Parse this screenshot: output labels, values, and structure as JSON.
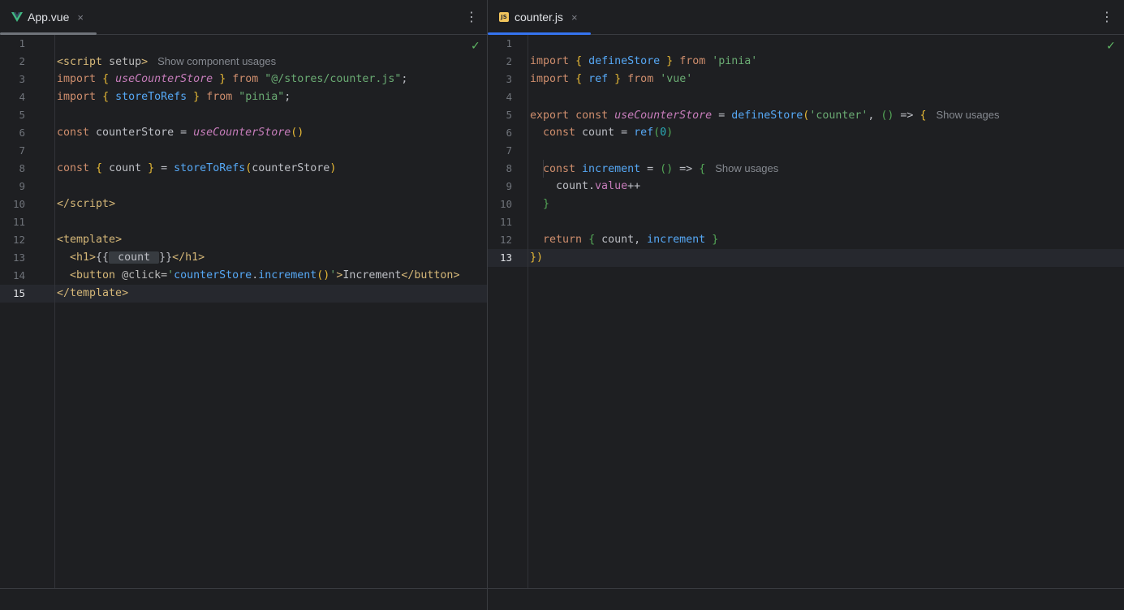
{
  "left": {
    "tab": {
      "label": "App.vue",
      "icon": "vue-icon",
      "close": "×"
    },
    "more": "⋮",
    "check": "✓",
    "hint_script": "Show component usages",
    "current_line": "15",
    "line_numbers": [
      "1",
      "2",
      "3",
      "4",
      "5",
      "6",
      "7",
      "8",
      "9",
      "10",
      "11",
      "12",
      "13",
      "14",
      "15"
    ]
  },
  "right": {
    "tab": {
      "label": "counter.js",
      "icon": "js-icon",
      "icon_text": "JS",
      "close": "×"
    },
    "more": "⋮",
    "check": "✓",
    "hint_usages_1": "Show usages",
    "hint_usages_2": "Show usages",
    "current_line": "13",
    "line_numbers": [
      "1",
      "2",
      "3",
      "4",
      "5",
      "6",
      "7",
      "8",
      "9",
      "10",
      "11",
      "12",
      "13"
    ]
  },
  "code_left": {
    "l1": [
      "<",
      "script",
      " setup",
      ">"
    ],
    "l2": [
      "import",
      " ",
      "{",
      " ",
      "useCounterStore",
      " ",
      "}",
      " ",
      "from",
      " ",
      "\"@/stores/counter.js\"",
      ";"
    ],
    "l3": [
      "import",
      " ",
      "{",
      " ",
      "storeToRefs",
      " ",
      "}",
      " ",
      "from",
      " ",
      "\"pinia\"",
      ";"
    ],
    "l5": [
      "const",
      " counterStore = ",
      "useCounterStore",
      "()"
    ],
    "l7": [
      "const",
      " ",
      "{",
      " count ",
      "}",
      " = ",
      "storeToRefs",
      "(",
      "counterStore",
      ")"
    ],
    "l9": [
      "</",
      "script",
      ">"
    ],
    "l11": [
      "<",
      "template",
      ">"
    ],
    "l12": [
      "<",
      "h1",
      ">",
      "{{",
      " count ",
      "}}",
      "</",
      "h1",
      ">"
    ],
    "l13": [
      "<",
      "button",
      " @click=",
      "'",
      "counterStore",
      ".",
      "increment",
      "()",
      "'",
      ">",
      "Increment",
      "</",
      "button",
      ">"
    ],
    "l14": [
      "</",
      "template",
      ">"
    ]
  },
  "code_right": {
    "l1": [
      "import",
      " ",
      "{",
      " ",
      "defineStore",
      " ",
      "}",
      " ",
      "from",
      " ",
      "'pinia'"
    ],
    "l2": [
      "import",
      " ",
      "{",
      " ",
      "ref",
      " ",
      "}",
      " ",
      "from",
      " ",
      "'vue'"
    ],
    "l4": [
      "export",
      " ",
      "const",
      " ",
      "useCounterStore",
      " = ",
      "defineStore",
      "(",
      "'counter'",
      ", ",
      "()",
      " => ",
      "{"
    ],
    "l5": [
      "const",
      " count = ",
      "ref",
      "(",
      "0",
      ")"
    ],
    "l7": [
      "const",
      " ",
      "increment",
      " = ",
      "()",
      " => ",
      "{"
    ],
    "l8": [
      "count",
      ".",
      "value",
      "++"
    ],
    "l9": [
      "}"
    ],
    "l11": [
      "return",
      " ",
      "{",
      " count, ",
      "increment",
      " ",
      "}"
    ],
    "l12": [
      "}",
      ")"
    ]
  },
  "colors": {
    "background": "#1e1f22",
    "keyword": "#cf8e6d",
    "function": "#56a8f5",
    "string": "#6aab73",
    "number": "#2aacb8",
    "tag": "#d5b778",
    "italic_fn": "#c77dbb",
    "active_tab_underline": "#3574f0",
    "inactive_tab_underline": "#6f737a"
  }
}
